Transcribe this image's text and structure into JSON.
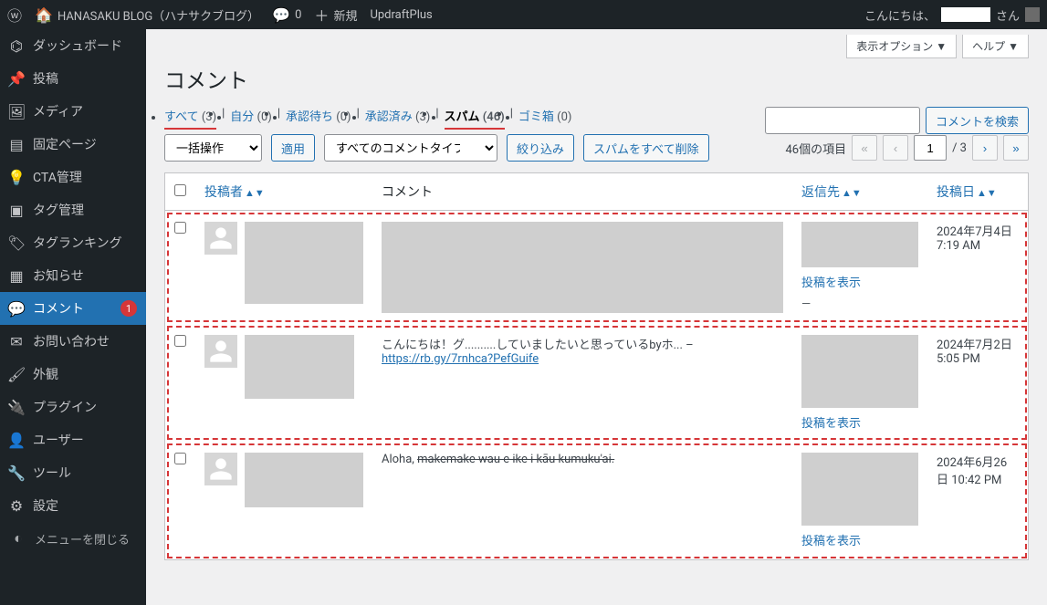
{
  "adminbar": {
    "siteTitle": "HANASAKU BLOG（ハナサクブログ）",
    "commentsCount": "0",
    "newLabel": "新規",
    "updraft": "UpdraftPlus",
    "greeting": "こんにちは、",
    "userSuffix": "さん"
  },
  "sidebar": {
    "dashboard": "ダッシュボード",
    "posts": "投稿",
    "media": "メディア",
    "pages": "固定ページ",
    "cta": "CTA管理",
    "tags": "タグ管理",
    "tagrank": "タグランキング",
    "notice": "お知らせ",
    "comments": "コメント",
    "commentsBadge": "1",
    "contact": "お問い合わせ",
    "appearance": "外観",
    "plugins": "プラグイン",
    "users": "ユーザー",
    "tools": "ツール",
    "settings": "設定",
    "collapse": "メニューを閉じる"
  },
  "screenMeta": {
    "screenOptions": "表示オプション ▼",
    "help": "ヘルプ ▼"
  },
  "pageTitle": "コメント",
  "filters": {
    "all": "すべて",
    "allCount": "(3)",
    "mine": "自分",
    "mineCount": "(0)",
    "pending": "承認待ち",
    "pendingCount": "(0)",
    "approved": "承認済み",
    "approvedCount": "(3)",
    "spam": "スパム",
    "spamCount": "(46)",
    "trash": "ゴミ箱",
    "trashCount": "(0)"
  },
  "bulk": {
    "placeholder": "一括操作",
    "apply": "適用",
    "typePlaceholder": "すべてのコメントタイプ",
    "filter": "絞り込み",
    "emptySpam": "スパムをすべて削除"
  },
  "search": {
    "button": "コメントを検索"
  },
  "pagination": {
    "itemsLabel": "46個の項目",
    "page": "1",
    "totalPages": "/ 3"
  },
  "columns": {
    "author": "投稿者",
    "comment": "コメント",
    "replyTo": "返信先",
    "date": "投稿日"
  },
  "rows": [
    {
      "commentText": "",
      "link": "",
      "viewPost": "投稿を表示",
      "dash": "—",
      "date": "2024年7月4日 7:19 AM"
    },
    {
      "commentText": "こんにちは！グ..........していましたいと思っているbyホ... –",
      "link": "https://rb.gy/7rnhca?PefGuife",
      "viewPost": "投稿を表示",
      "date": "2024年7月2日 5:05 PM"
    },
    {
      "commentText": "Aloha,",
      "strike": "makemake wau e ike i kāu kumuku'ai.",
      "viewPost": "投稿を表示",
      "date": "2024年6月26日 10:42 PM"
    }
  ]
}
